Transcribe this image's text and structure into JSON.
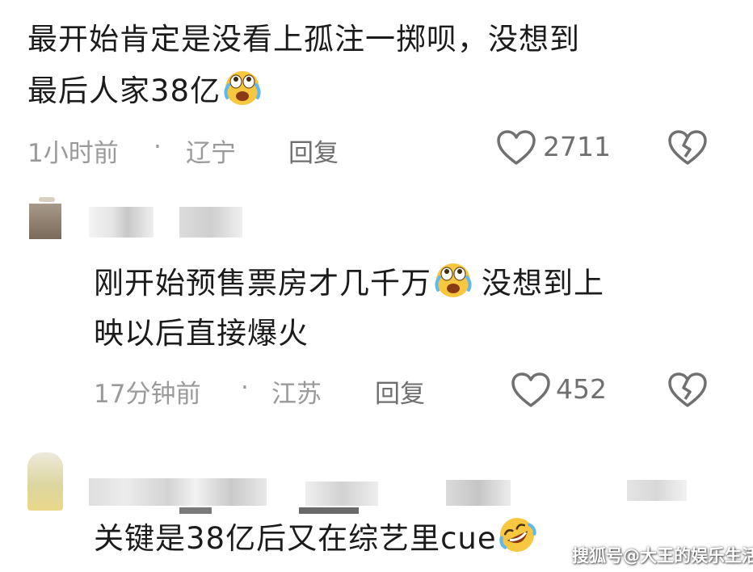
{
  "comments": [
    {
      "text_line1": "最开始肯定是没看上孤注一掷呗，没想到",
      "text_line2": "最后人家38亿",
      "time": "1小时前",
      "dot": "·",
      "location": "辽宁",
      "reply_label": "回复",
      "likes": "2711"
    },
    {
      "text_line1_a": "刚开始预售票房才几千万",
      "text_line1_b": "没想到上",
      "text_line2": "映以后直接爆火",
      "time": "17分钟前",
      "dot": "·",
      "location": "江苏",
      "reply_label": "回复",
      "likes": "452"
    },
    {
      "text_line1": "关键是38亿后又在综艺里cue"
    }
  ],
  "icons": {
    "like": "heart-outline-icon",
    "dislike": "broken-heart-icon",
    "emoji_laugh_cry": "laugh-cry-emoji",
    "emoji_rofl": "rofl-emoji"
  },
  "watermark": "搜狐号@大王的娱乐生活",
  "colors": {
    "text": "#1b1b1b",
    "meta": "#9a9a9a",
    "reply": "#6f6f6f",
    "emoji_yellow": "#f7c740"
  }
}
